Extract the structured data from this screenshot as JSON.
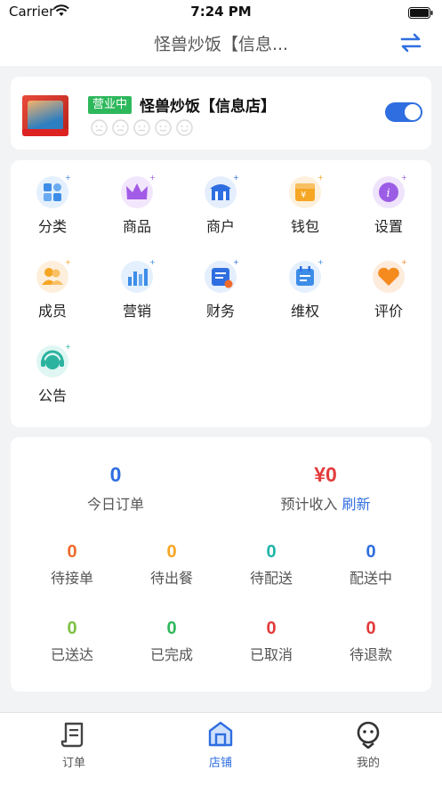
{
  "status_bar": {
    "carrier": "Carrier",
    "time": "7:24 PM"
  },
  "navbar": {
    "title": "怪兽炒饭【信息...",
    "switch_icon": "swap-arrows-icon"
  },
  "store": {
    "status_badge": "营业中",
    "name": "怪兽炒饭【信息店】",
    "rating_faces": 5,
    "open_toggle_on": true
  },
  "menu": {
    "items": [
      {
        "label": "分类",
        "icon": "category-grid-icon",
        "color": "#3d8de8"
      },
      {
        "label": "商品",
        "icon": "crown-icon",
        "color": "#a25be6"
      },
      {
        "label": "商户",
        "icon": "storefront-icon",
        "color": "#2f6ee0"
      },
      {
        "label": "钱包",
        "icon": "wallet-icon",
        "color": "#f5a623"
      },
      {
        "label": "设置",
        "icon": "info-settings-icon",
        "color": "#9b5de5"
      },
      {
        "label": "成员",
        "icon": "members-icon",
        "color": "#f5a623"
      },
      {
        "label": "营销",
        "icon": "bar-chart-icon",
        "color": "#3d8de8"
      },
      {
        "label": "财务",
        "icon": "finance-doc-icon",
        "color": "#2f6ee0"
      },
      {
        "label": "维权",
        "icon": "calendar-doc-icon",
        "color": "#3d8de8"
      },
      {
        "label": "评价",
        "icon": "heart-icon",
        "color": "#f58a1f"
      },
      {
        "label": "公告",
        "icon": "headset-icon",
        "color": "#2bb3a0"
      }
    ]
  },
  "stats": {
    "today_orders": {
      "value": "0",
      "label": "今日订单",
      "color": "#2f6ee0"
    },
    "expected_income": {
      "value": "¥0",
      "label": "预计收入",
      "refresh": "刷新",
      "color": "#e23b3b"
    },
    "row1": [
      {
        "value": "0",
        "label": "待接单",
        "color": "#f06a2a"
      },
      {
        "value": "0",
        "label": "待出餐",
        "color": "#f5a623"
      },
      {
        "value": "0",
        "label": "待配送",
        "color": "#1fb5a8"
      },
      {
        "value": "0",
        "label": "配送中",
        "color": "#2f6ee0"
      }
    ],
    "row2": [
      {
        "value": "0",
        "label": "已送达",
        "color": "#7cc242"
      },
      {
        "value": "0",
        "label": "已完成",
        "color": "#2eb85c"
      },
      {
        "value": "0",
        "label": "已取消",
        "color": "#e23b3b"
      },
      {
        "value": "0",
        "label": "待退款",
        "color": "#e23b3b"
      }
    ]
  },
  "tabbar": {
    "tabs": [
      {
        "label": "订单",
        "icon": "orders-icon",
        "active": false
      },
      {
        "label": "店铺",
        "icon": "shop-icon",
        "active": true
      },
      {
        "label": "我的",
        "icon": "profile-face-icon",
        "active": false
      }
    ]
  }
}
